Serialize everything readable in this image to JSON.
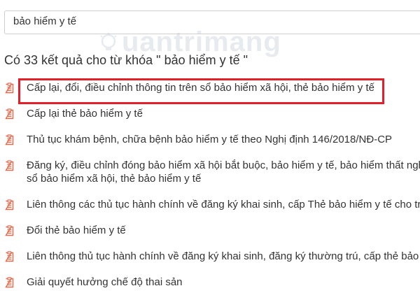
{
  "search": {
    "value": "bảo hiểm y tế"
  },
  "watermark": {
    "text": "uantrimang",
    "icon": "lightbulb-logo-icon"
  },
  "results": {
    "heading": "Có 33 kết quả cho từ khóa \" bảo hiểm y tế \"",
    "item_icon": "document-icon",
    "highlight_color": "#e3202a",
    "icon_color": "#e4694a",
    "items": [
      {
        "lines": [
          "Cấp lại, đổi, điều chỉnh thông tin trên sổ bảo hiểm xã hội, thẻ bảo hiểm y tế"
        ],
        "highlighted": true
      },
      {
        "lines": [
          "Cấp lại thẻ bảo hiểm y tế"
        ]
      },
      {
        "lines": [
          "Thủ tục khám bệnh, chữa bệnh bảo hiểm y tế theo Nghị định 146/2018/NĐ-CP"
        ]
      },
      {
        "lines": [
          "Đăng ký, điều chỉnh đóng bảo hiểm xã hội bắt buộc, bảo hiểm y tế, bảo hiểm thất nghi",
          "sổ bảo hiểm xã hội, thẻ bảo hiểm y tế"
        ]
      },
      {
        "lines": [
          "Liên thông các thủ tục hành chính về đăng ký khai sinh, cấp Thẻ bảo hiểm y tế cho trẻ e"
        ]
      },
      {
        "lines": [
          "Đổi thẻ bảo hiểm y tế"
        ]
      },
      {
        "lines": [
          "Liên thông thủ tục hành chính về đăng ký khai sinh, đăng ký thường trú, cấp thẻ bảo hi"
        ]
      },
      {
        "lines": [
          "Giải quyết hưởng chế độ thai sản"
        ]
      }
    ]
  }
}
